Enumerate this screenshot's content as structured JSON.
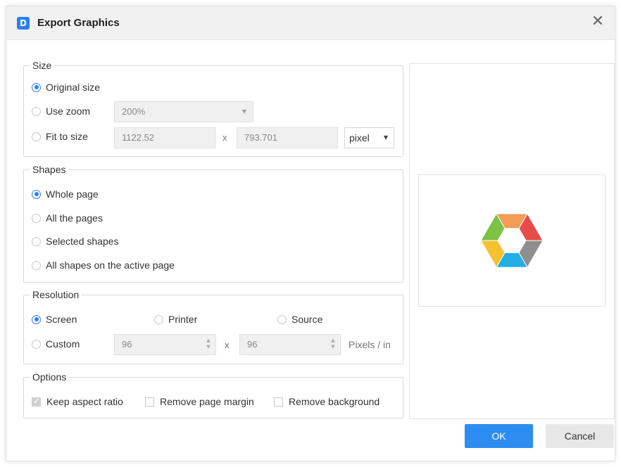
{
  "dialog": {
    "title": "Export Graphics",
    "app_icon": "document-app-icon",
    "close_glyph": "✕"
  },
  "size": {
    "legend": "Size",
    "original_label": "Original size",
    "zoom_label": "Use zoom",
    "zoom_value": "200%",
    "fit_label": "Fit to size",
    "width_value": "1122.52",
    "separator": "x",
    "height_value": "793.701",
    "unit_value": "pixel",
    "selected": "Original size"
  },
  "shapes": {
    "legend": "Shapes",
    "options": [
      "Whole page",
      "All the pages",
      "Selected shapes",
      "All shapes on the active page"
    ],
    "selected": "Whole page"
  },
  "resolution": {
    "legend": "Resolution",
    "screen_label": "Screen",
    "printer_label": "Printer",
    "source_label": "Source",
    "custom_label": "Custom",
    "x_value": "96",
    "separator": "x",
    "y_value": "96",
    "unit_label": "Pixels / in",
    "selected": "Screen"
  },
  "options": {
    "legend": "Options",
    "keep_aspect_label": "Keep aspect ratio",
    "keep_aspect_checked": true,
    "remove_margin_label": "Remove page margin",
    "remove_margin_checked": false,
    "remove_background_label": "Remove background",
    "remove_background_checked": false
  },
  "preview": {
    "segment_colors": [
      "#f39c55",
      "#e74c4c",
      "#8f8f8f",
      "#23aee5",
      "#f6c22f",
      "#7cc244"
    ]
  },
  "buttons": {
    "ok_label": "OK",
    "cancel_label": "Cancel"
  },
  "colors": {
    "accent": "#2d8cf0"
  }
}
